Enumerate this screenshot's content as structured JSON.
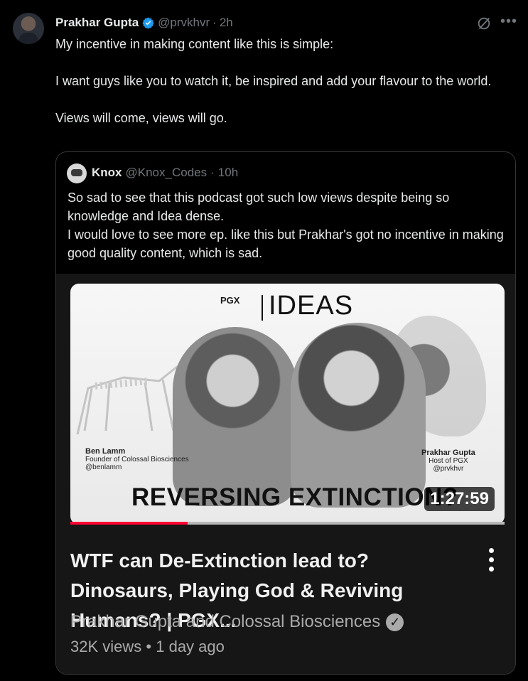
{
  "tweet": {
    "author_name": "Prakhar Gupta",
    "handle": "@prvkhvr",
    "separator": "·",
    "time": "2h",
    "text": "My incentive in making content like this is simple:\n\nI want guys like you to watch it, be inspired and add your flavour to the world.\n\nViews will come, views will go."
  },
  "quote": {
    "author_name": "Knox",
    "handle": "@Knox_Codes",
    "separator": "·",
    "time": "10h",
    "text": "So sad to see that this podcast got such low views despite being so knowledge and Idea dense.\nI would love to see more ep. like this but Prakhar's got no incentive in making good quality content, which is sad."
  },
  "video": {
    "thumbnail_logo": "PGX",
    "thumbnail_brand": "IDEAS",
    "left_person_name": "Ben Lamm",
    "left_person_role": "Founder of Colossal Biosciences",
    "left_person_handle": "@benlamm",
    "right_person_name": "Prakhar Gupta",
    "right_person_role": "Host of PGX",
    "right_person_handle": "@prvkhvr",
    "thumbnail_title": "REVERSING EXTINCTION?",
    "duration": "1:27:59",
    "watched_fraction": 0.27,
    "title": "WTF can De-Extinction lead to? Dinosaurs, Playing God & Reviving Humans? | PGX...",
    "channel": "Prakhar Gupta and Colossal Biosciences",
    "views": "32K views",
    "meta_separator": "•",
    "age": "1 day ago"
  },
  "colors": {
    "background": "#000000",
    "text_primary": "#e7e9ea",
    "text_secondary": "#71767b",
    "verified": "#1d9bf0",
    "progress": "#ff0033"
  },
  "icons": [
    "verified-badge-icon",
    "grok-icon",
    "more-options-icon",
    "video-menu-icon",
    "channel-verified-icon"
  ]
}
